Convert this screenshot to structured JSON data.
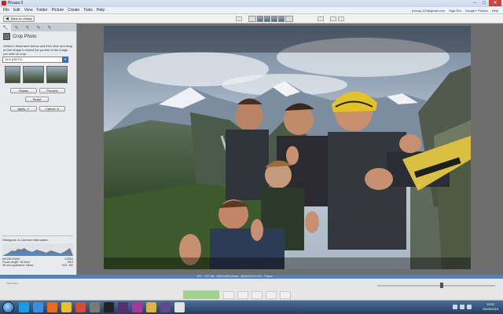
{
  "window": {
    "title": "Picasa 3"
  },
  "menu": {
    "items": [
      "File",
      "Edit",
      "View",
      "Folder",
      "Picture",
      "Create",
      "Tools",
      "Help"
    ]
  },
  "account": {
    "email": "jvnnap 123@gmail.com",
    "links": [
      "Sign Out",
      "Google+ Photos",
      "Help"
    ]
  },
  "toolbar": {
    "back_label": "Back to Library",
    "play_label": "Play"
  },
  "panel": {
    "tabs": [
      "wrench-icon",
      "brush-icon",
      "sun-icon",
      "brush-icon",
      "brush-icon"
    ],
    "title": "Crop Photo",
    "instructions": "Select a dimension below and then click and drag on the image to select the portion of the image you wish to crop.",
    "aspect_select": "16:9 (HDTV)",
    "buttons": {
      "rotate": "Rotate",
      "preview": "Preview",
      "reset": "Reset",
      "apply": "Apply",
      "cancel": "Cancel"
    },
    "histogram": {
      "title": "Histogram & Camera Information",
      "camera": "NIKON D3300",
      "focal": "Focal Length: 18.0mm",
      "equiv": "35 mm-equivalent: 18mm",
      "shutter": "1/2000",
      "aperture": "f/8.0",
      "iso": "ISO: 100"
    }
  },
  "statusbar": {
    "text": "JPG   ·   4.97 Mb   ·   6000×4000 pixels   ·   20/09/2015 10:11   ·   Picasa"
  },
  "tray": {
    "label": "Selection"
  },
  "clock": {
    "time": "10:52",
    "date": "20/09/2015"
  },
  "taskbar": {
    "apps": [
      "skype-icon",
      "ie-icon",
      "firefox-icon",
      "chrome-icon",
      "picasa-icon",
      "media-icon",
      "vlc-icon",
      "illustrator-icon",
      "word-icon",
      "folder-icon",
      "premiere-icon",
      "note-icon"
    ]
  },
  "colors": {
    "accent": "#4f7fc7",
    "taskbar": "#253e5e",
    "selection": "#a3d18f"
  }
}
